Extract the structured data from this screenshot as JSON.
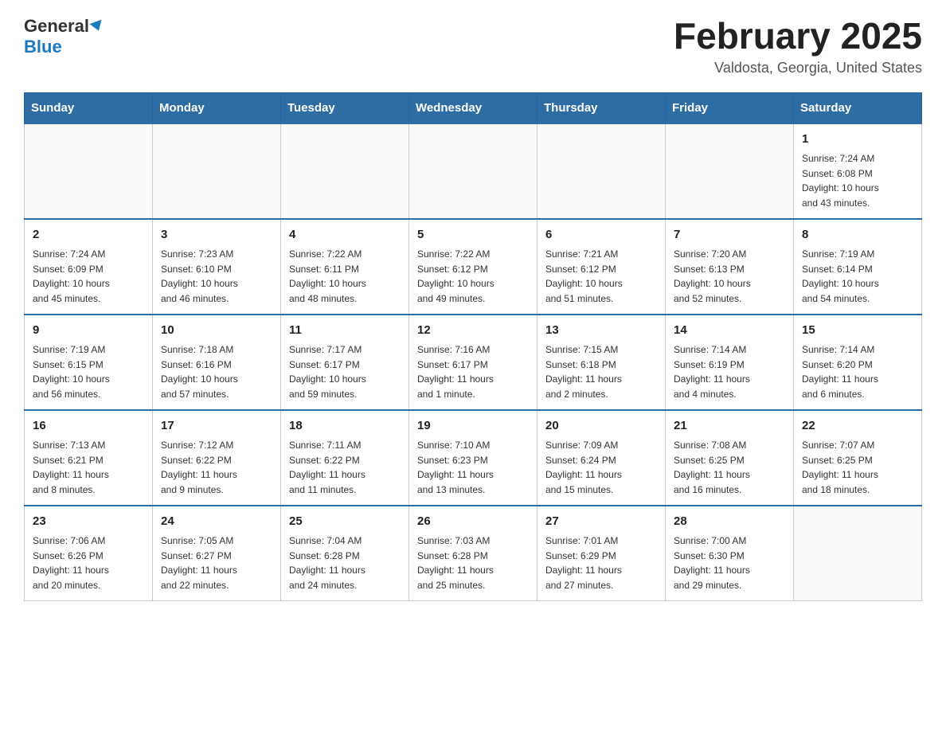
{
  "header": {
    "logo_general": "General",
    "logo_blue": "Blue",
    "title": "February 2025",
    "subtitle": "Valdosta, Georgia, United States"
  },
  "days_of_week": [
    "Sunday",
    "Monday",
    "Tuesday",
    "Wednesday",
    "Thursday",
    "Friday",
    "Saturday"
  ],
  "weeks": [
    [
      {
        "day": "",
        "info": ""
      },
      {
        "day": "",
        "info": ""
      },
      {
        "day": "",
        "info": ""
      },
      {
        "day": "",
        "info": ""
      },
      {
        "day": "",
        "info": ""
      },
      {
        "day": "",
        "info": ""
      },
      {
        "day": "1",
        "info": "Sunrise: 7:24 AM\nSunset: 6:08 PM\nDaylight: 10 hours\nand 43 minutes."
      }
    ],
    [
      {
        "day": "2",
        "info": "Sunrise: 7:24 AM\nSunset: 6:09 PM\nDaylight: 10 hours\nand 45 minutes."
      },
      {
        "day": "3",
        "info": "Sunrise: 7:23 AM\nSunset: 6:10 PM\nDaylight: 10 hours\nand 46 minutes."
      },
      {
        "day": "4",
        "info": "Sunrise: 7:22 AM\nSunset: 6:11 PM\nDaylight: 10 hours\nand 48 minutes."
      },
      {
        "day": "5",
        "info": "Sunrise: 7:22 AM\nSunset: 6:12 PM\nDaylight: 10 hours\nand 49 minutes."
      },
      {
        "day": "6",
        "info": "Sunrise: 7:21 AM\nSunset: 6:12 PM\nDaylight: 10 hours\nand 51 minutes."
      },
      {
        "day": "7",
        "info": "Sunrise: 7:20 AM\nSunset: 6:13 PM\nDaylight: 10 hours\nand 52 minutes."
      },
      {
        "day": "8",
        "info": "Sunrise: 7:19 AM\nSunset: 6:14 PM\nDaylight: 10 hours\nand 54 minutes."
      }
    ],
    [
      {
        "day": "9",
        "info": "Sunrise: 7:19 AM\nSunset: 6:15 PM\nDaylight: 10 hours\nand 56 minutes."
      },
      {
        "day": "10",
        "info": "Sunrise: 7:18 AM\nSunset: 6:16 PM\nDaylight: 10 hours\nand 57 minutes."
      },
      {
        "day": "11",
        "info": "Sunrise: 7:17 AM\nSunset: 6:17 PM\nDaylight: 10 hours\nand 59 minutes."
      },
      {
        "day": "12",
        "info": "Sunrise: 7:16 AM\nSunset: 6:17 PM\nDaylight: 11 hours\nand 1 minute."
      },
      {
        "day": "13",
        "info": "Sunrise: 7:15 AM\nSunset: 6:18 PM\nDaylight: 11 hours\nand 2 minutes."
      },
      {
        "day": "14",
        "info": "Sunrise: 7:14 AM\nSunset: 6:19 PM\nDaylight: 11 hours\nand 4 minutes."
      },
      {
        "day": "15",
        "info": "Sunrise: 7:14 AM\nSunset: 6:20 PM\nDaylight: 11 hours\nand 6 minutes."
      }
    ],
    [
      {
        "day": "16",
        "info": "Sunrise: 7:13 AM\nSunset: 6:21 PM\nDaylight: 11 hours\nand 8 minutes."
      },
      {
        "day": "17",
        "info": "Sunrise: 7:12 AM\nSunset: 6:22 PM\nDaylight: 11 hours\nand 9 minutes."
      },
      {
        "day": "18",
        "info": "Sunrise: 7:11 AM\nSunset: 6:22 PM\nDaylight: 11 hours\nand 11 minutes."
      },
      {
        "day": "19",
        "info": "Sunrise: 7:10 AM\nSunset: 6:23 PM\nDaylight: 11 hours\nand 13 minutes."
      },
      {
        "day": "20",
        "info": "Sunrise: 7:09 AM\nSunset: 6:24 PM\nDaylight: 11 hours\nand 15 minutes."
      },
      {
        "day": "21",
        "info": "Sunrise: 7:08 AM\nSunset: 6:25 PM\nDaylight: 11 hours\nand 16 minutes."
      },
      {
        "day": "22",
        "info": "Sunrise: 7:07 AM\nSunset: 6:25 PM\nDaylight: 11 hours\nand 18 minutes."
      }
    ],
    [
      {
        "day": "23",
        "info": "Sunrise: 7:06 AM\nSunset: 6:26 PM\nDaylight: 11 hours\nand 20 minutes."
      },
      {
        "day": "24",
        "info": "Sunrise: 7:05 AM\nSunset: 6:27 PM\nDaylight: 11 hours\nand 22 minutes."
      },
      {
        "day": "25",
        "info": "Sunrise: 7:04 AM\nSunset: 6:28 PM\nDaylight: 11 hours\nand 24 minutes."
      },
      {
        "day": "26",
        "info": "Sunrise: 7:03 AM\nSunset: 6:28 PM\nDaylight: 11 hours\nand 25 minutes."
      },
      {
        "day": "27",
        "info": "Sunrise: 7:01 AM\nSunset: 6:29 PM\nDaylight: 11 hours\nand 27 minutes."
      },
      {
        "day": "28",
        "info": "Sunrise: 7:00 AM\nSunset: 6:30 PM\nDaylight: 11 hours\nand 29 minutes."
      },
      {
        "day": "",
        "info": ""
      }
    ]
  ],
  "colors": {
    "header_bg": "#2e6da4",
    "header_text": "#ffffff",
    "border": "#aaaaaa",
    "cell_border": "#cccccc"
  }
}
